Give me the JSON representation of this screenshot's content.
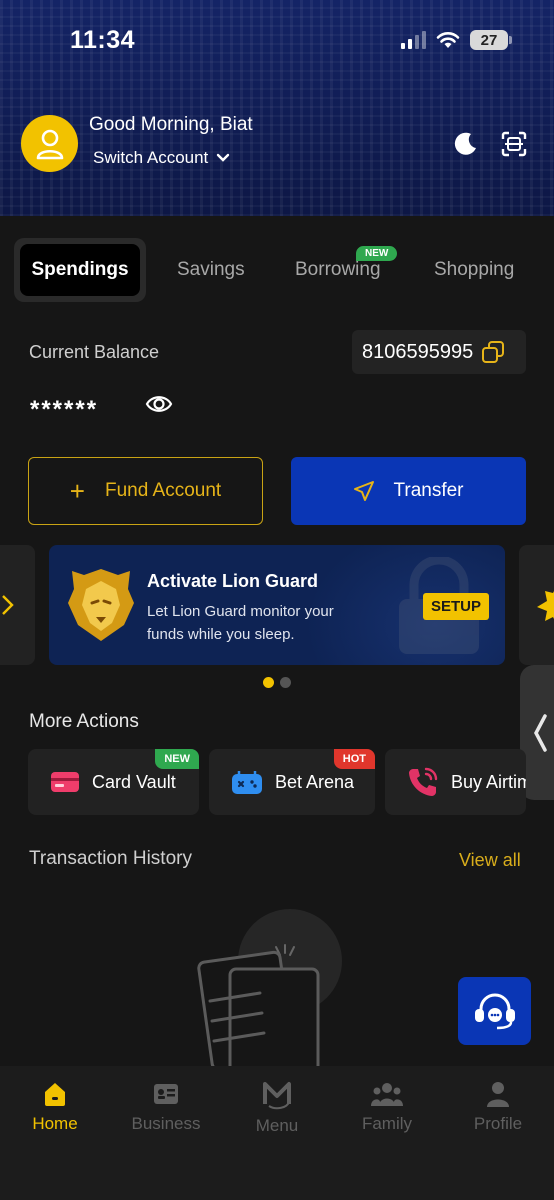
{
  "status_bar": {
    "time": "11:34",
    "battery": "27"
  },
  "header": {
    "greeting": "Good Morning,  Biat",
    "switch_account": "Switch Account"
  },
  "tabs": [
    {
      "label": "Spendings",
      "active": true
    },
    {
      "label": "Savings"
    },
    {
      "label": "Borrowing",
      "badge": "NEW"
    },
    {
      "label": "Shopping"
    }
  ],
  "balance": {
    "label": "Current Balance",
    "account_number": "8106595995",
    "masked_value": "******"
  },
  "buttons": {
    "fund": "Fund Account",
    "transfer": "Transfer"
  },
  "promo": {
    "title": "Activate Lion Guard",
    "text": "Let Lion Guard monitor your funds while you sleep.",
    "cta": "SETUP"
  },
  "more_actions": {
    "title": "More Actions",
    "items": [
      {
        "label": "Card Vault",
        "tag": "NEW",
        "tag_color": "#2fa84f",
        "icon": "card-icon"
      },
      {
        "label": "Bet Arena",
        "tag": "HOT",
        "tag_color": "#e0362c",
        "icon": "gamepad-icon"
      },
      {
        "label": "Buy Airtime",
        "icon": "phone-icon"
      }
    ]
  },
  "transactions": {
    "title": "Transaction History",
    "view_all": "View all"
  },
  "bottom_nav": [
    {
      "label": "Home",
      "icon": "home-icon",
      "active": true
    },
    {
      "label": "Business",
      "icon": "business-icon"
    },
    {
      "label": "Menu",
      "icon": "menu-logo-icon"
    },
    {
      "label": "Family",
      "icon": "family-icon"
    },
    {
      "label": "Profile",
      "icon": "profile-icon"
    }
  ],
  "colors": {
    "accent": "#f2c200",
    "primary": "#0a36b5",
    "background": "#161616"
  }
}
